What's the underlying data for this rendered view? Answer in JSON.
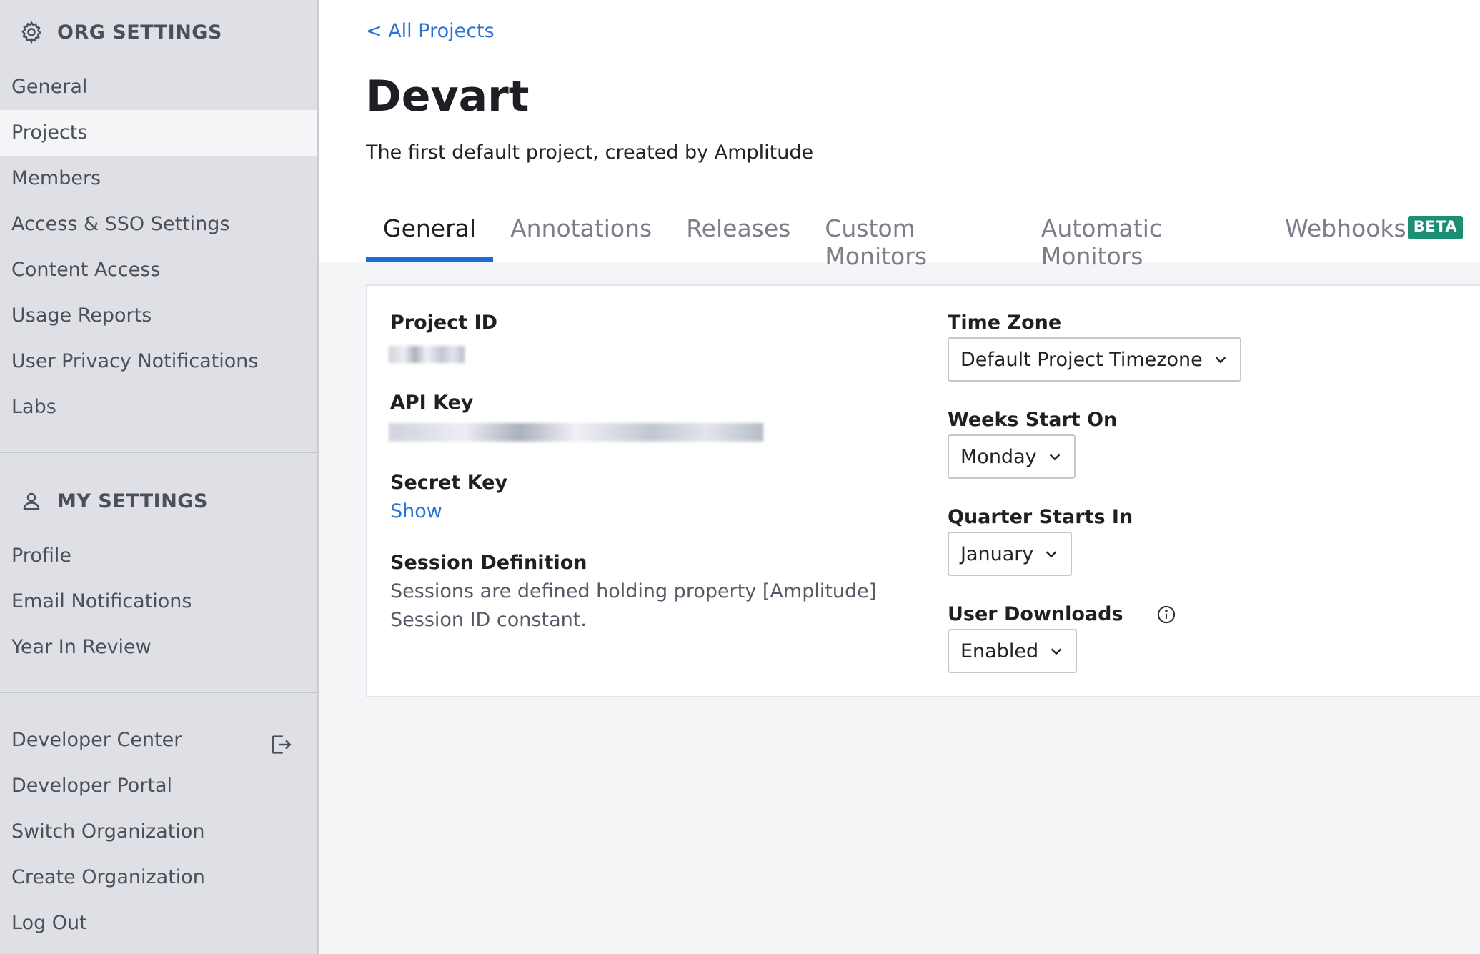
{
  "sidebar": {
    "org_heading": "ORG SETTINGS",
    "org_items": [
      {
        "label": "General"
      },
      {
        "label": "Projects",
        "active": true
      },
      {
        "label": "Members"
      },
      {
        "label": "Access & SSO Settings"
      },
      {
        "label": "Content Access"
      },
      {
        "label": "Usage Reports"
      },
      {
        "label": "User Privacy Notifications"
      },
      {
        "label": "Labs"
      }
    ],
    "my_heading": "MY SETTINGS",
    "my_items": [
      {
        "label": "Profile"
      },
      {
        "label": "Email Notifications"
      },
      {
        "label": "Year In Review"
      }
    ],
    "footer_items": [
      {
        "label": "Developer Center",
        "icon": "external-link-icon"
      },
      {
        "label": "Developer Portal"
      },
      {
        "label": "Switch Organization"
      },
      {
        "label": "Create Organization"
      },
      {
        "label": "Log Out"
      }
    ]
  },
  "main": {
    "back_link": "< All Projects",
    "title": "Devart",
    "description": "The first default project, created by Amplitude",
    "tabs": [
      {
        "label": "General",
        "active": true
      },
      {
        "label": "Annotations"
      },
      {
        "label": "Releases"
      },
      {
        "label": "Custom Monitors"
      },
      {
        "label": "Automatic Monitors"
      },
      {
        "label": "Webhooks",
        "badge": "BETA"
      }
    ],
    "left_fields": {
      "project_id_label": "Project ID",
      "api_key_label": "API Key",
      "secret_key_label": "Secret Key",
      "secret_key_action": "Show",
      "session_def_label": "Session Definition",
      "session_def_text": "Sessions are defined holding property [Amplitude] Session ID constant."
    },
    "right_fields": {
      "timezone_label": "Time Zone",
      "timezone_value": "Default Project Timezone",
      "weeks_label": "Weeks Start On",
      "weeks_value": "Monday",
      "quarter_label": "Quarter Starts In",
      "quarter_value": "January",
      "downloads_label": "User Downloads",
      "downloads_value": "Enabled"
    }
  },
  "colors": {
    "accent": "#1e6ad8",
    "link": "#2c73d6",
    "beta_badge": "#1c8f72",
    "sidebar_bg": "#dfe0e5"
  }
}
